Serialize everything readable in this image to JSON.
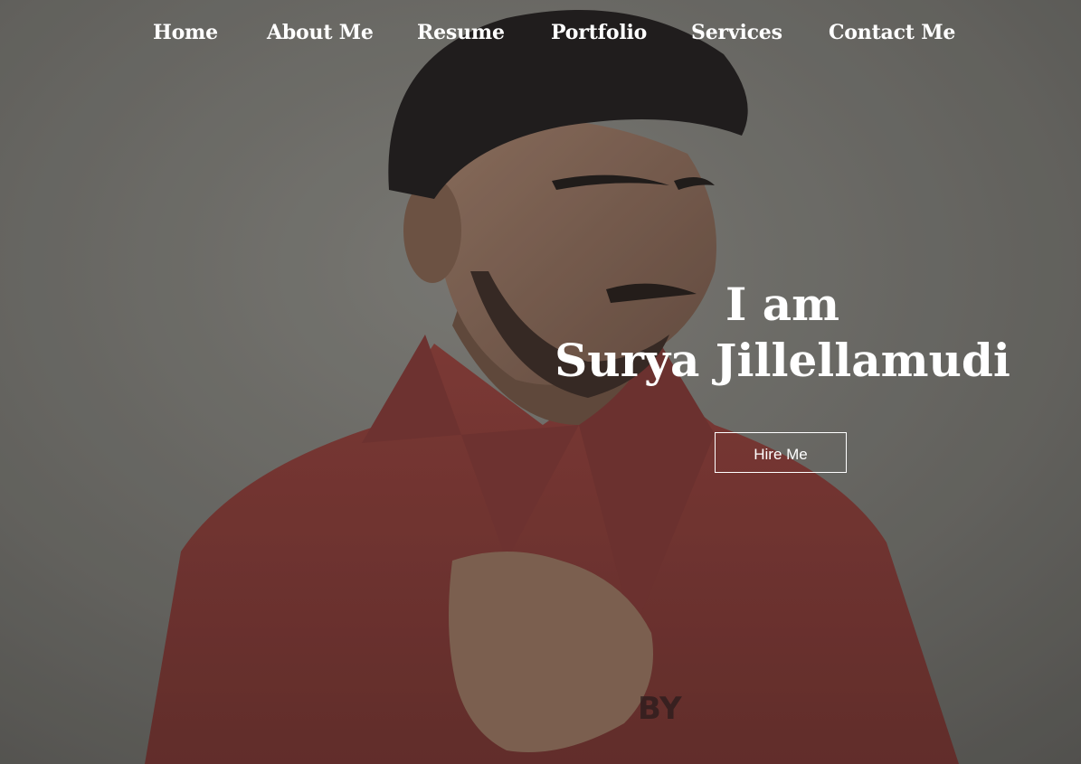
{
  "nav": {
    "items": [
      {
        "label": "Home"
      },
      {
        "label": "About Me"
      },
      {
        "label": "Resume"
      },
      {
        "label": "Portfolio"
      },
      {
        "label": "Services"
      },
      {
        "label": "Contact Me"
      }
    ]
  },
  "hero": {
    "line1": "I am",
    "line2": "Surya Jillellamudi",
    "cta_label": "Hire Me"
  },
  "colors": {
    "text": "#ffffff",
    "background": "#6d6c68",
    "shirt": "#8a3a36",
    "hair": "#1e1c1c",
    "skin": "#8a6a58"
  }
}
